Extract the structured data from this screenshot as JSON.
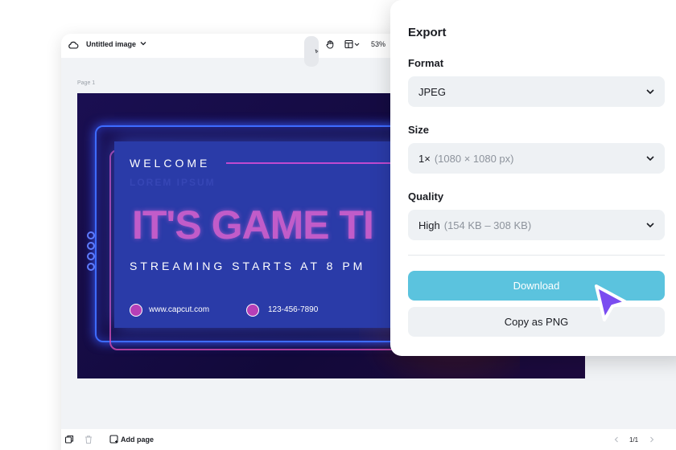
{
  "editor": {
    "title": "Untitled image",
    "zoom": "53%",
    "page_label": "Page 1",
    "add_page_label": "Add page",
    "page_count": "1/1"
  },
  "artwork": {
    "welcome": "WELCOME",
    "lorem": "LOREM IPSUM",
    "headline": "IT'S GAME TI",
    "subhead": "STREAMING STARTS AT 8 PM",
    "website": "www.capcut.com",
    "phone": "123-456-7890"
  },
  "export": {
    "title": "Export",
    "format_label": "Format",
    "format_value": "JPEG",
    "size_label": "Size",
    "size_value": "1×",
    "size_detail": "(1080 × 1080 px)",
    "quality_label": "Quality",
    "quality_value": "High",
    "quality_detail": "(154 KB – 308 KB)",
    "download_label": "Download",
    "copy_png_label": "Copy as PNG"
  },
  "colors": {
    "accent": "#5bc3de",
    "cursor": "#7a4cf0",
    "headline": "#c15cc9"
  }
}
